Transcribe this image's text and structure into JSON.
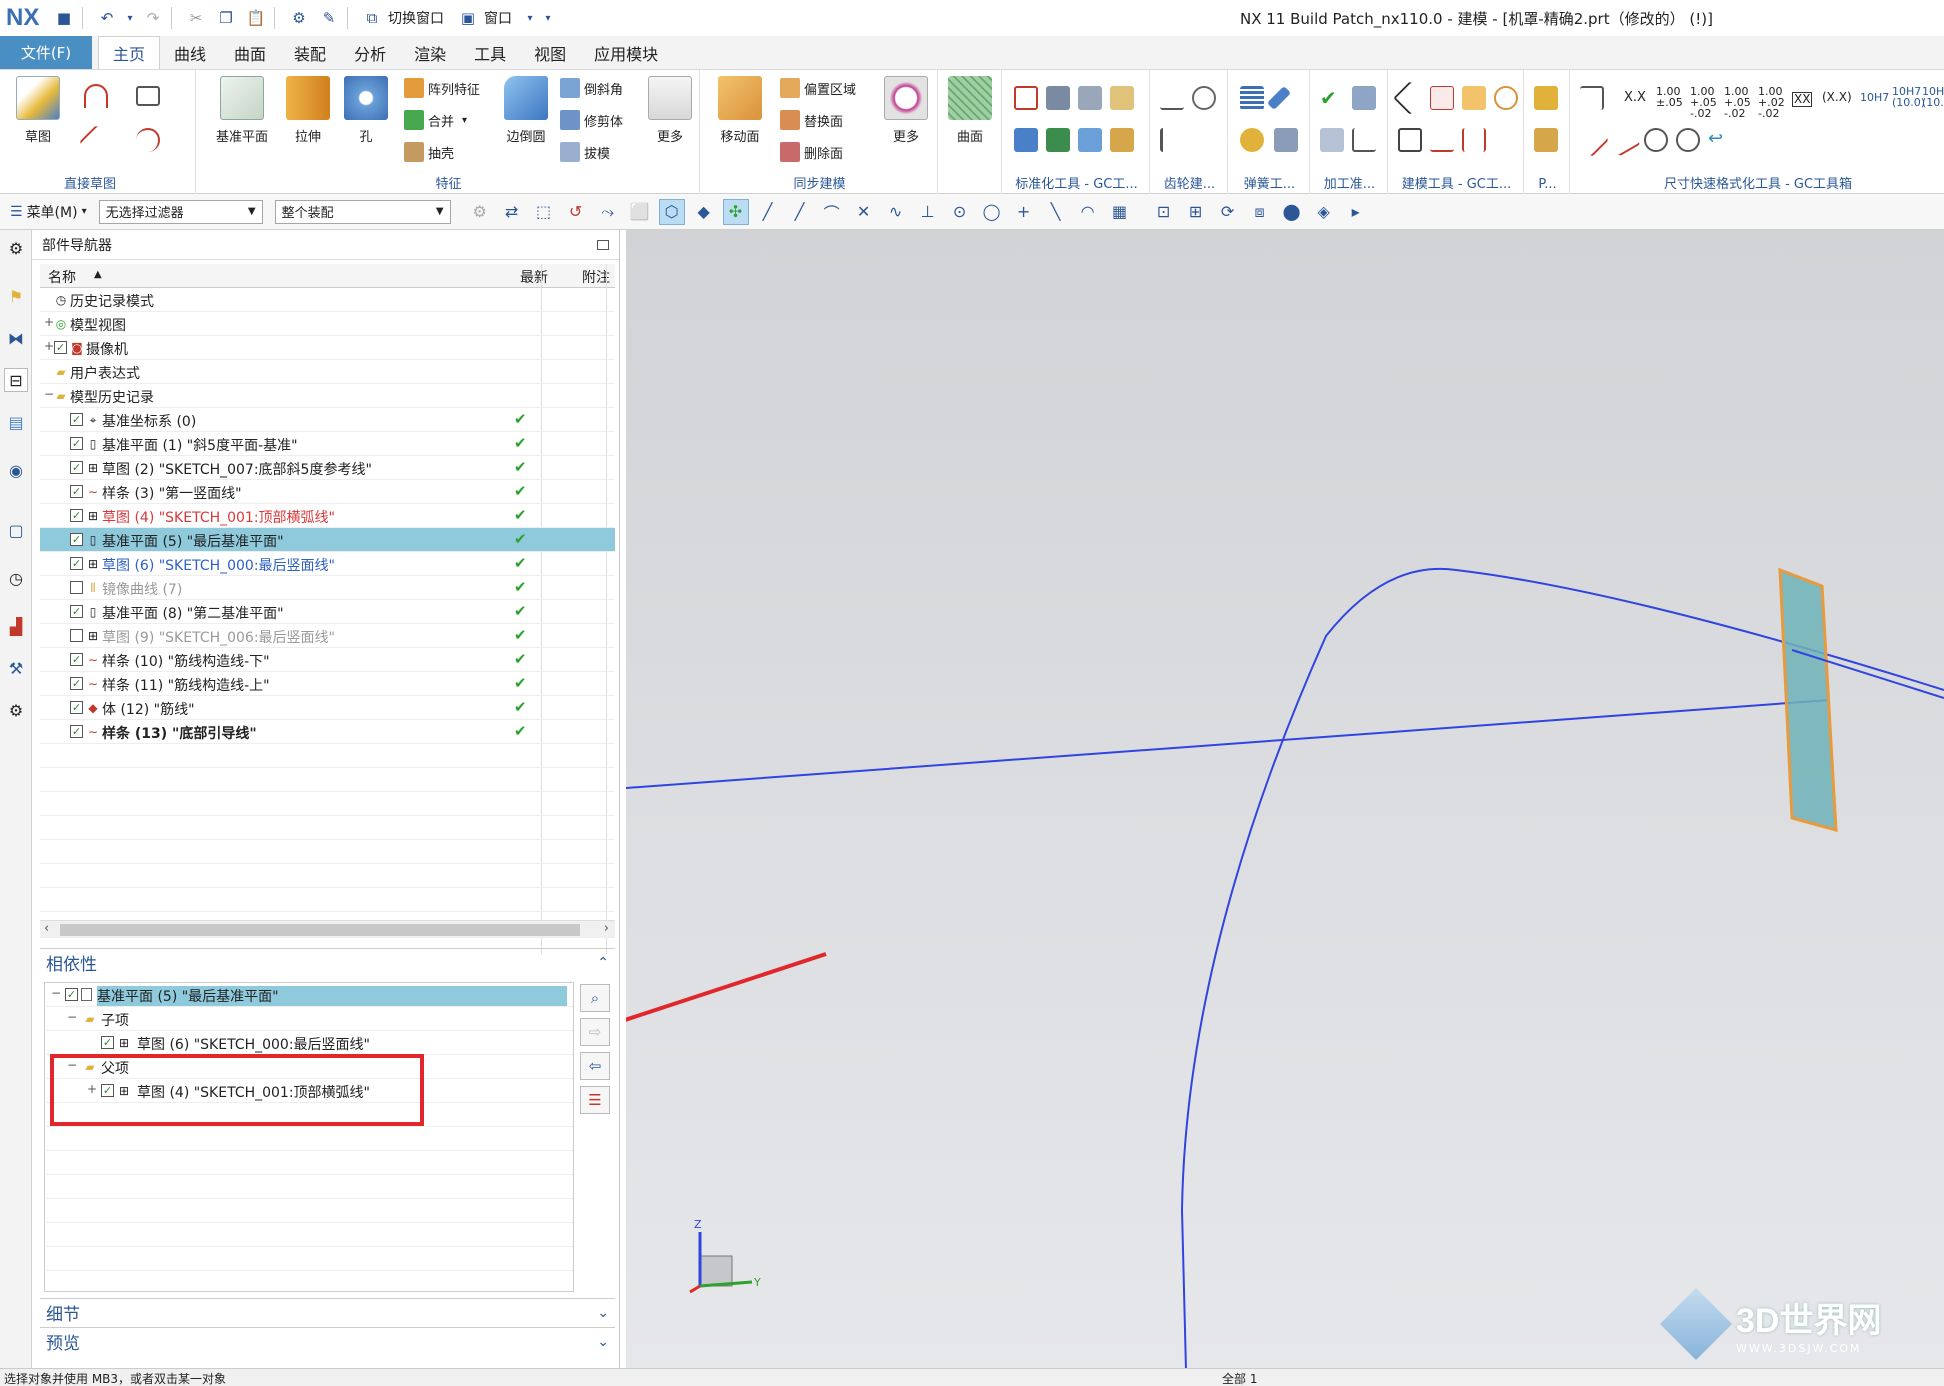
{
  "window": {
    "logo": "NX",
    "title": "NX 11  Build Patch_nx110.0 - 建模 - [机罩-精确2.prt（修改的）   (!)]",
    "qa_switch_window": "切换窗口",
    "qa_window": "窗口"
  },
  "menu": {
    "file": "文件(F)",
    "tabs": [
      "主页",
      "曲线",
      "曲面",
      "装配",
      "分析",
      "渲染",
      "工具",
      "视图",
      "应用模块"
    ]
  },
  "ribbon": {
    "sketch": "草图",
    "direct_sketch": "直接草图",
    "datum_plane": "基准平面",
    "extrude": "拉伸",
    "hole": "孔",
    "pattern_feature": "阵列特征",
    "unite": "合并",
    "shell": "抽壳",
    "edge_blend": "边倒圆",
    "chamfer": "倒斜角",
    "trim_body": "修剪体",
    "draft": "拔模",
    "more1": "更多",
    "feature": "特征",
    "move_face": "移动面",
    "offset_region": "偏置区域",
    "replace_face": "替换面",
    "delete_face": "删除面",
    "more2": "更多",
    "sync_modeling": "同步建模",
    "surface": "曲面",
    "std_tools": "标准化工具 - GC工...",
    "gear": "齿轮建...",
    "spring": "弹簧工...",
    "machining": "加工准...",
    "modeling_tools": "建模工具 - GC工...",
    "p_group": "P...",
    "dim_tools": "尺寸快速格式化工具 - GC工具箱",
    "dim_labels": [
      "X.X",
      "1.00\n±.05",
      "1.00\n+.05\n-.02",
      "1.00\n+.05\n-.02",
      "1.00\n+.02\n-.02",
      "XX",
      "(X.X)",
      "10H7",
      "10H7\n(10.0)",
      "10H\n(10."
    ]
  },
  "selection_bar": {
    "menu": "菜单(M)",
    "filter": "无选择过滤器",
    "scope": "整个装配"
  },
  "navigator": {
    "title": "部件导航器",
    "col_name": "名称",
    "col_latest": "最新",
    "col_note": "附注",
    "nodes": [
      {
        "label": "历史记录模式",
        "indent": 0,
        "check": "none",
        "latest": "",
        "style": "normal",
        "icon": "clock-icon"
      },
      {
        "label": "模型视图",
        "indent": 0,
        "check": "none",
        "latest": "",
        "style": "normal",
        "icon": "view-icon",
        "expand": "+"
      },
      {
        "label": "摄像机",
        "indent": 0,
        "check": "checked",
        "latest": "",
        "style": "normal",
        "icon": "camera-icon",
        "expand": "+"
      },
      {
        "label": "用户表达式",
        "indent": 0,
        "check": "none",
        "latest": "",
        "style": "normal",
        "icon": "folder-icon"
      },
      {
        "label": "模型历史记录",
        "indent": 0,
        "check": "none",
        "latest": "",
        "style": "normal",
        "icon": "folder-icon",
        "expand": "−"
      },
      {
        "label": "基准坐标系 (0)",
        "indent": 1,
        "check": "checked",
        "latest": "✔",
        "style": "normal",
        "icon": "csys-icon"
      },
      {
        "label": "基准平面 (1) \"斜5度平面-基准\"",
        "indent": 1,
        "check": "checked",
        "latest": "✔",
        "style": "normal",
        "icon": "plane-icon"
      },
      {
        "label": "草图 (2) \"SKETCH_007:底部斜5度参考线\"",
        "indent": 1,
        "check": "checked",
        "latest": "✔",
        "style": "normal",
        "icon": "sketch-icon"
      },
      {
        "label": "样条 (3) \"第一竖面线\"",
        "indent": 1,
        "check": "checked",
        "latest": "✔",
        "style": "normal",
        "icon": "spline-icon"
      },
      {
        "label": "草图 (4) \"SKETCH_001:顶部横弧线\"",
        "indent": 1,
        "check": "checked",
        "latest": "✔",
        "style": "red",
        "icon": "sketch-icon"
      },
      {
        "label": "基准平面 (5) \"最后基准平面\"",
        "indent": 1,
        "check": "checked",
        "latest": "✔",
        "style": "selected",
        "icon": "plane-icon"
      },
      {
        "label": "草图 (6) \"SKETCH_000:最后竖面线\"",
        "indent": 1,
        "check": "checked",
        "latest": "✔",
        "style": "blue",
        "icon": "sketch-icon"
      },
      {
        "label": "镜像曲线 (7)",
        "indent": 1,
        "check": "unchecked",
        "latest": "✔",
        "style": "gray",
        "icon": "mirror-icon"
      },
      {
        "label": "基准平面 (8) \"第二基准平面\"",
        "indent": 1,
        "check": "checked",
        "latest": "✔",
        "style": "normal",
        "icon": "plane-icon"
      },
      {
        "label": "草图 (9) \"SKETCH_006:最后竖面线\"",
        "indent": 1,
        "check": "unchecked",
        "latest": "✔",
        "style": "gray",
        "icon": "sketch-icon"
      },
      {
        "label": "样条 (10) \"筋线构造线-下\"",
        "indent": 1,
        "check": "checked",
        "latest": "✔",
        "style": "normal",
        "icon": "spline-icon"
      },
      {
        "label": "样条 (11) \"筋线构造线-上\"",
        "indent": 1,
        "check": "checked",
        "latest": "✔",
        "style": "normal",
        "icon": "spline-icon"
      },
      {
        "label": "体 (12) \"筋线\"",
        "indent": 1,
        "check": "checked",
        "latest": "✔",
        "style": "normal",
        "icon": "body-icon"
      },
      {
        "label": "样条 (13) \"底部引导线\"",
        "indent": 1,
        "check": "checked",
        "latest": "✔",
        "style": "bold",
        "icon": "spline-icon"
      }
    ]
  },
  "dependencies": {
    "title": "相依性",
    "root": "基准平面 (5) \"最后基准平面\"",
    "children_label": "子项",
    "child": "草图 (6) \"SKETCH_000:最后竖面线\"",
    "parents_label": "父项",
    "parent": "草图 (4) \"SKETCH_001:顶部横弧线\""
  },
  "details": {
    "title": "细节"
  },
  "preview": {
    "title": "预览"
  },
  "triad": {
    "z": "Z",
    "y": "Y"
  },
  "status": {
    "left": "选择对象并使用 MB3，或者双击某一对象",
    "center": "全部 1"
  },
  "watermark": {
    "brand": "3D世界网",
    "url": "WWW.3DSJW.COM"
  },
  "colors": {
    "accent": "#4a8fc4",
    "selection": "#8ec9dc",
    "curve": "#3044e0",
    "plane_fill": "#6fb3b8",
    "plane_edge": "#e89a3c",
    "annotation": "#e0282c",
    "red_text": "#d9383a",
    "blue_text": "#2d5fc5"
  }
}
